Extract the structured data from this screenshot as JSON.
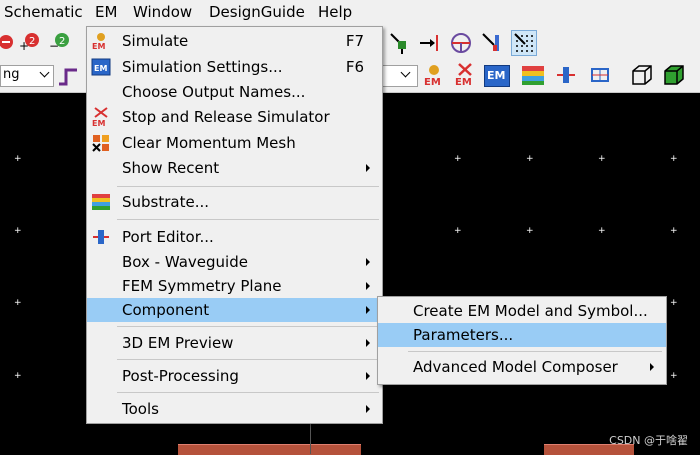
{
  "menubar": {
    "items": [
      "Schematic",
      "EM",
      "Window",
      "DesignGuide",
      "Help"
    ]
  },
  "toolbar": {
    "combo_value": "ng",
    "em_label": "EM"
  },
  "em_menu": {
    "items": [
      {
        "label": "Simulate",
        "shortcut": "F7"
      },
      {
        "label": "Simulation Settings...",
        "shortcut": "F6"
      },
      {
        "label": "Choose Output Names..."
      },
      {
        "label": "Stop and Release Simulator"
      },
      {
        "label": "Clear Momentum Mesh"
      },
      {
        "label": "Show Recent"
      },
      {
        "label": "Substrate..."
      },
      {
        "label": "Port Editor..."
      },
      {
        "label": "Box - Waveguide"
      },
      {
        "label": "FEM Symmetry Plane"
      },
      {
        "label": "Component"
      },
      {
        "label": "3D EM Preview"
      },
      {
        "label": "Post-Processing"
      },
      {
        "label": "Tools"
      }
    ]
  },
  "component_submenu": {
    "items": [
      {
        "label": "Create EM Model and Symbol..."
      },
      {
        "label": "Parameters..."
      },
      {
        "label": "Advanced Model Composer"
      }
    ]
  },
  "watermark": "CSDN @于啥翟",
  "colors": {
    "highlight": "#99ccf5",
    "canvas": "#000000",
    "menu_bg": "#f0f0f0",
    "block": "#b5523b"
  }
}
